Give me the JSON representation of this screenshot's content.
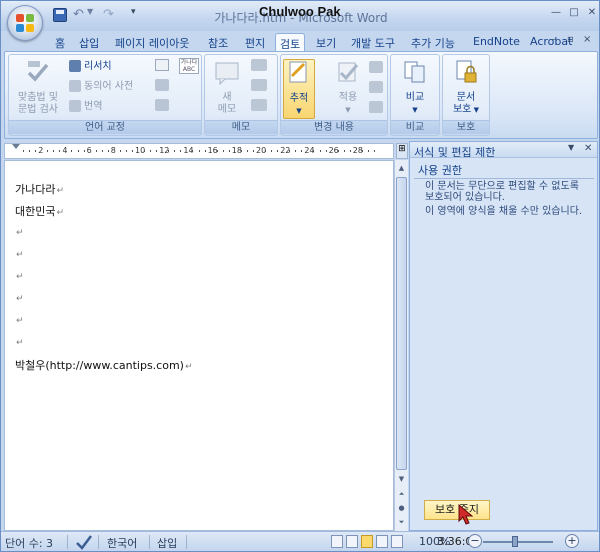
{
  "app": {
    "title": "가나다라.htm - Microsoft Word",
    "watermark": "Chulwoo Pak"
  },
  "tabs": [
    {
      "label": "홈"
    },
    {
      "label": "삽입"
    },
    {
      "label": "페이지 레이아웃"
    },
    {
      "label": "참조"
    },
    {
      "label": "편지"
    },
    {
      "label": "검토",
      "active": true
    },
    {
      "label": "보기"
    },
    {
      "label": "개발 도구"
    },
    {
      "label": "추가 기능"
    },
    {
      "label": "EndNote"
    },
    {
      "label": "Acrobat"
    }
  ],
  "ribbon": {
    "proofing": {
      "label": "언어 교정",
      "spelling_line1": "맞춤법 및",
      "spelling_line2": "문법 검사",
      "research": "리서치",
      "thesaurus": "동의어 사전",
      "translate": "번역",
      "word_count_badge_top": "가나다",
      "word_count_badge_bottom": "ABC"
    },
    "comments": {
      "label": "메모",
      "new_line1": "새",
      "new_line2": "메모"
    },
    "tracking": {
      "label": "변경 내용",
      "track": "추적",
      "accept": "적용"
    },
    "compare": {
      "label": "비교",
      "button": "비교"
    },
    "protect": {
      "label": "보호",
      "btn_line1": "문서",
      "btn_line2": "보호"
    }
  },
  "ruler": {
    "numbers": [
      "2",
      "4",
      "6",
      "8",
      "10",
      "12",
      "14",
      "16",
      "18",
      "20",
      "22",
      "24",
      "26",
      "28"
    ]
  },
  "document": {
    "lines": [
      "가나다라",
      "대한민국",
      "",
      "",
      "",
      "",
      "",
      "",
      "박철우(http://www.cantips.com)"
    ],
    "paragraph_mark": "↵"
  },
  "taskpane": {
    "title": "서식 및 편집 제한",
    "section": "사용 권한",
    "text1": "이 문서는 무단으로 편집할 수 없도록 보호되어 있습니다.",
    "text2": "이 영역에 양식을 채울 수만 있습니다.",
    "stop_button": "보호 중지"
  },
  "statusbar": {
    "word_count": "단어 수: 3",
    "language": "한국어",
    "mode": "삽입",
    "zoom": "100%",
    "time": "3:36:06"
  },
  "colors": {
    "accent": "#15428b",
    "ribbon_bg": "#dbe7f7",
    "active_button": "#fde38b"
  }
}
